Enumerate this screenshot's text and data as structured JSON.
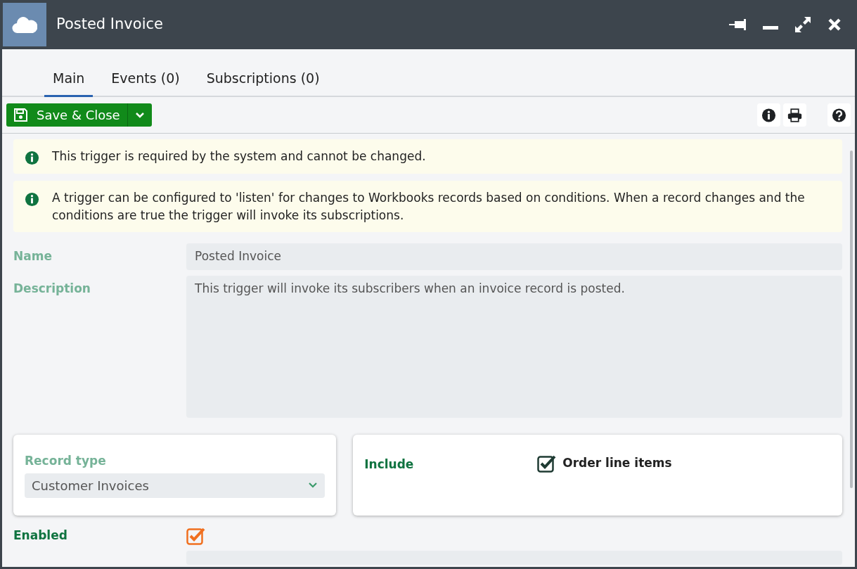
{
  "window": {
    "title": "Posted Invoice"
  },
  "tabs": [
    {
      "label": "Main",
      "selected": true
    },
    {
      "label": "Events (0)",
      "selected": false
    },
    {
      "label": "Subscriptions (0)",
      "selected": false
    }
  ],
  "toolbar": {
    "save_button": "Save & Close"
  },
  "notices": [
    "This trigger is required by the system and cannot be changed.",
    "A trigger can be configured to 'listen' for changes to Workbooks records based on conditions. When a record changes and the conditions are true the trigger will invoke its subscriptions."
  ],
  "fields": [
    {
      "kind": "input",
      "label": "Name",
      "value": "Posted Invoice",
      "disabled": true
    },
    {
      "kind": "textarea",
      "label": "Description",
      "value": "This trigger will invoke its subscribers when an invoice record is posted.",
      "disabled": true
    }
  ],
  "record_type": {
    "label": "Record type",
    "value": "Customer Invoices"
  },
  "include": {
    "label": "Include",
    "option": "Order line items",
    "checked": true
  },
  "enabled": {
    "label": "Enabled",
    "checked": true
  }
}
